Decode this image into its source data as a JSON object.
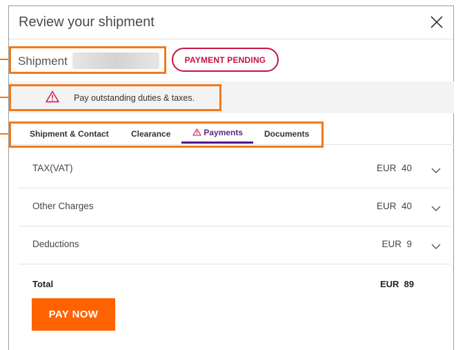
{
  "modal": {
    "title": "Review your shipment",
    "close_icon": "close-icon"
  },
  "shipment": {
    "label": "Shipment",
    "status_badge": "PAYMENT PENDING"
  },
  "alert": {
    "icon": "warning-triangle-icon",
    "message": "Pay outstanding duties & taxes."
  },
  "tabs": [
    {
      "label": "Shipment & Contact"
    },
    {
      "label": "Clearance"
    },
    {
      "label": "Payments",
      "icon": "warning-triangle-icon",
      "active": true
    },
    {
      "label": "Documents"
    }
  ],
  "charges": [
    {
      "label": "TAX(VAT)",
      "amount": "EUR  40"
    },
    {
      "label": "Other Charges",
      "amount": "EUR  40"
    },
    {
      "label": "Deductions",
      "amount": "EUR  9"
    }
  ],
  "total": {
    "label": "Total",
    "amount": "EUR  89"
  },
  "pay_button": {
    "label": "PAY NOW"
  },
  "colors": {
    "highlight": "#f07a1a",
    "badge": "#c8103e",
    "active_tab": "#4d148c",
    "pay_button": "#ff6200",
    "alert_icon": "#c8103e"
  }
}
